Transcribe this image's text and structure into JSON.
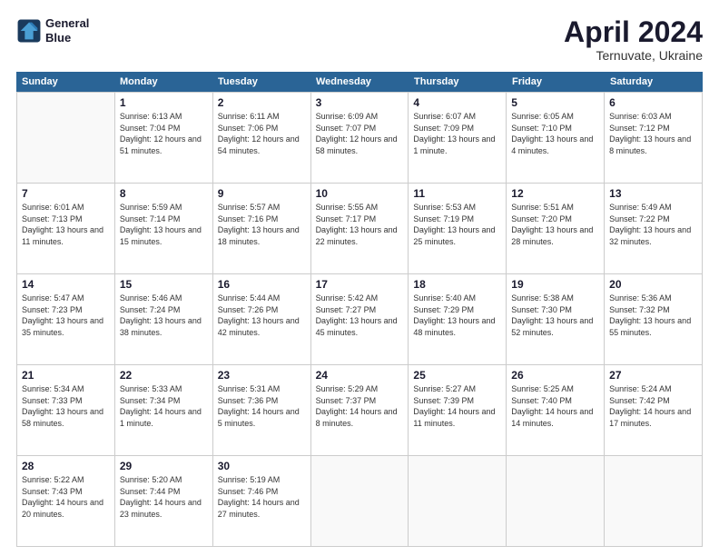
{
  "header": {
    "logo_line1": "General",
    "logo_line2": "Blue",
    "title": "April 2024",
    "subtitle": "Ternuvate, Ukraine"
  },
  "days": [
    "Sunday",
    "Monday",
    "Tuesday",
    "Wednesday",
    "Thursday",
    "Friday",
    "Saturday"
  ],
  "weeks": [
    [
      {
        "day": "",
        "sunrise": "",
        "sunset": "",
        "daylight": ""
      },
      {
        "day": "1",
        "sunrise": "Sunrise: 6:13 AM",
        "sunset": "Sunset: 7:04 PM",
        "daylight": "Daylight: 12 hours and 51 minutes."
      },
      {
        "day": "2",
        "sunrise": "Sunrise: 6:11 AM",
        "sunset": "Sunset: 7:06 PM",
        "daylight": "Daylight: 12 hours and 54 minutes."
      },
      {
        "day": "3",
        "sunrise": "Sunrise: 6:09 AM",
        "sunset": "Sunset: 7:07 PM",
        "daylight": "Daylight: 12 hours and 58 minutes."
      },
      {
        "day": "4",
        "sunrise": "Sunrise: 6:07 AM",
        "sunset": "Sunset: 7:09 PM",
        "daylight": "Daylight: 13 hours and 1 minute."
      },
      {
        "day": "5",
        "sunrise": "Sunrise: 6:05 AM",
        "sunset": "Sunset: 7:10 PM",
        "daylight": "Daylight: 13 hours and 4 minutes."
      },
      {
        "day": "6",
        "sunrise": "Sunrise: 6:03 AM",
        "sunset": "Sunset: 7:12 PM",
        "daylight": "Daylight: 13 hours and 8 minutes."
      }
    ],
    [
      {
        "day": "7",
        "sunrise": "Sunrise: 6:01 AM",
        "sunset": "Sunset: 7:13 PM",
        "daylight": "Daylight: 13 hours and 11 minutes."
      },
      {
        "day": "8",
        "sunrise": "Sunrise: 5:59 AM",
        "sunset": "Sunset: 7:14 PM",
        "daylight": "Daylight: 13 hours and 15 minutes."
      },
      {
        "day": "9",
        "sunrise": "Sunrise: 5:57 AM",
        "sunset": "Sunset: 7:16 PM",
        "daylight": "Daylight: 13 hours and 18 minutes."
      },
      {
        "day": "10",
        "sunrise": "Sunrise: 5:55 AM",
        "sunset": "Sunset: 7:17 PM",
        "daylight": "Daylight: 13 hours and 22 minutes."
      },
      {
        "day": "11",
        "sunrise": "Sunrise: 5:53 AM",
        "sunset": "Sunset: 7:19 PM",
        "daylight": "Daylight: 13 hours and 25 minutes."
      },
      {
        "day": "12",
        "sunrise": "Sunrise: 5:51 AM",
        "sunset": "Sunset: 7:20 PM",
        "daylight": "Daylight: 13 hours and 28 minutes."
      },
      {
        "day": "13",
        "sunrise": "Sunrise: 5:49 AM",
        "sunset": "Sunset: 7:22 PM",
        "daylight": "Daylight: 13 hours and 32 minutes."
      }
    ],
    [
      {
        "day": "14",
        "sunrise": "Sunrise: 5:47 AM",
        "sunset": "Sunset: 7:23 PM",
        "daylight": "Daylight: 13 hours and 35 minutes."
      },
      {
        "day": "15",
        "sunrise": "Sunrise: 5:46 AM",
        "sunset": "Sunset: 7:24 PM",
        "daylight": "Daylight: 13 hours and 38 minutes."
      },
      {
        "day": "16",
        "sunrise": "Sunrise: 5:44 AM",
        "sunset": "Sunset: 7:26 PM",
        "daylight": "Daylight: 13 hours and 42 minutes."
      },
      {
        "day": "17",
        "sunrise": "Sunrise: 5:42 AM",
        "sunset": "Sunset: 7:27 PM",
        "daylight": "Daylight: 13 hours and 45 minutes."
      },
      {
        "day": "18",
        "sunrise": "Sunrise: 5:40 AM",
        "sunset": "Sunset: 7:29 PM",
        "daylight": "Daylight: 13 hours and 48 minutes."
      },
      {
        "day": "19",
        "sunrise": "Sunrise: 5:38 AM",
        "sunset": "Sunset: 7:30 PM",
        "daylight": "Daylight: 13 hours and 52 minutes."
      },
      {
        "day": "20",
        "sunrise": "Sunrise: 5:36 AM",
        "sunset": "Sunset: 7:32 PM",
        "daylight": "Daylight: 13 hours and 55 minutes."
      }
    ],
    [
      {
        "day": "21",
        "sunrise": "Sunrise: 5:34 AM",
        "sunset": "Sunset: 7:33 PM",
        "daylight": "Daylight: 13 hours and 58 minutes."
      },
      {
        "day": "22",
        "sunrise": "Sunrise: 5:33 AM",
        "sunset": "Sunset: 7:34 PM",
        "daylight": "Daylight: 14 hours and 1 minute."
      },
      {
        "day": "23",
        "sunrise": "Sunrise: 5:31 AM",
        "sunset": "Sunset: 7:36 PM",
        "daylight": "Daylight: 14 hours and 5 minutes."
      },
      {
        "day": "24",
        "sunrise": "Sunrise: 5:29 AM",
        "sunset": "Sunset: 7:37 PM",
        "daylight": "Daylight: 14 hours and 8 minutes."
      },
      {
        "day": "25",
        "sunrise": "Sunrise: 5:27 AM",
        "sunset": "Sunset: 7:39 PM",
        "daylight": "Daylight: 14 hours and 11 minutes."
      },
      {
        "day": "26",
        "sunrise": "Sunrise: 5:25 AM",
        "sunset": "Sunset: 7:40 PM",
        "daylight": "Daylight: 14 hours and 14 minutes."
      },
      {
        "day": "27",
        "sunrise": "Sunrise: 5:24 AM",
        "sunset": "Sunset: 7:42 PM",
        "daylight": "Daylight: 14 hours and 17 minutes."
      }
    ],
    [
      {
        "day": "28",
        "sunrise": "Sunrise: 5:22 AM",
        "sunset": "Sunset: 7:43 PM",
        "daylight": "Daylight: 14 hours and 20 minutes."
      },
      {
        "day": "29",
        "sunrise": "Sunrise: 5:20 AM",
        "sunset": "Sunset: 7:44 PM",
        "daylight": "Daylight: 14 hours and 23 minutes."
      },
      {
        "day": "30",
        "sunrise": "Sunrise: 5:19 AM",
        "sunset": "Sunset: 7:46 PM",
        "daylight": "Daylight: 14 hours and 27 minutes."
      },
      {
        "day": "",
        "sunrise": "",
        "sunset": "",
        "daylight": ""
      },
      {
        "day": "",
        "sunrise": "",
        "sunset": "",
        "daylight": ""
      },
      {
        "day": "",
        "sunrise": "",
        "sunset": "",
        "daylight": ""
      },
      {
        "day": "",
        "sunrise": "",
        "sunset": "",
        "daylight": ""
      }
    ]
  ]
}
